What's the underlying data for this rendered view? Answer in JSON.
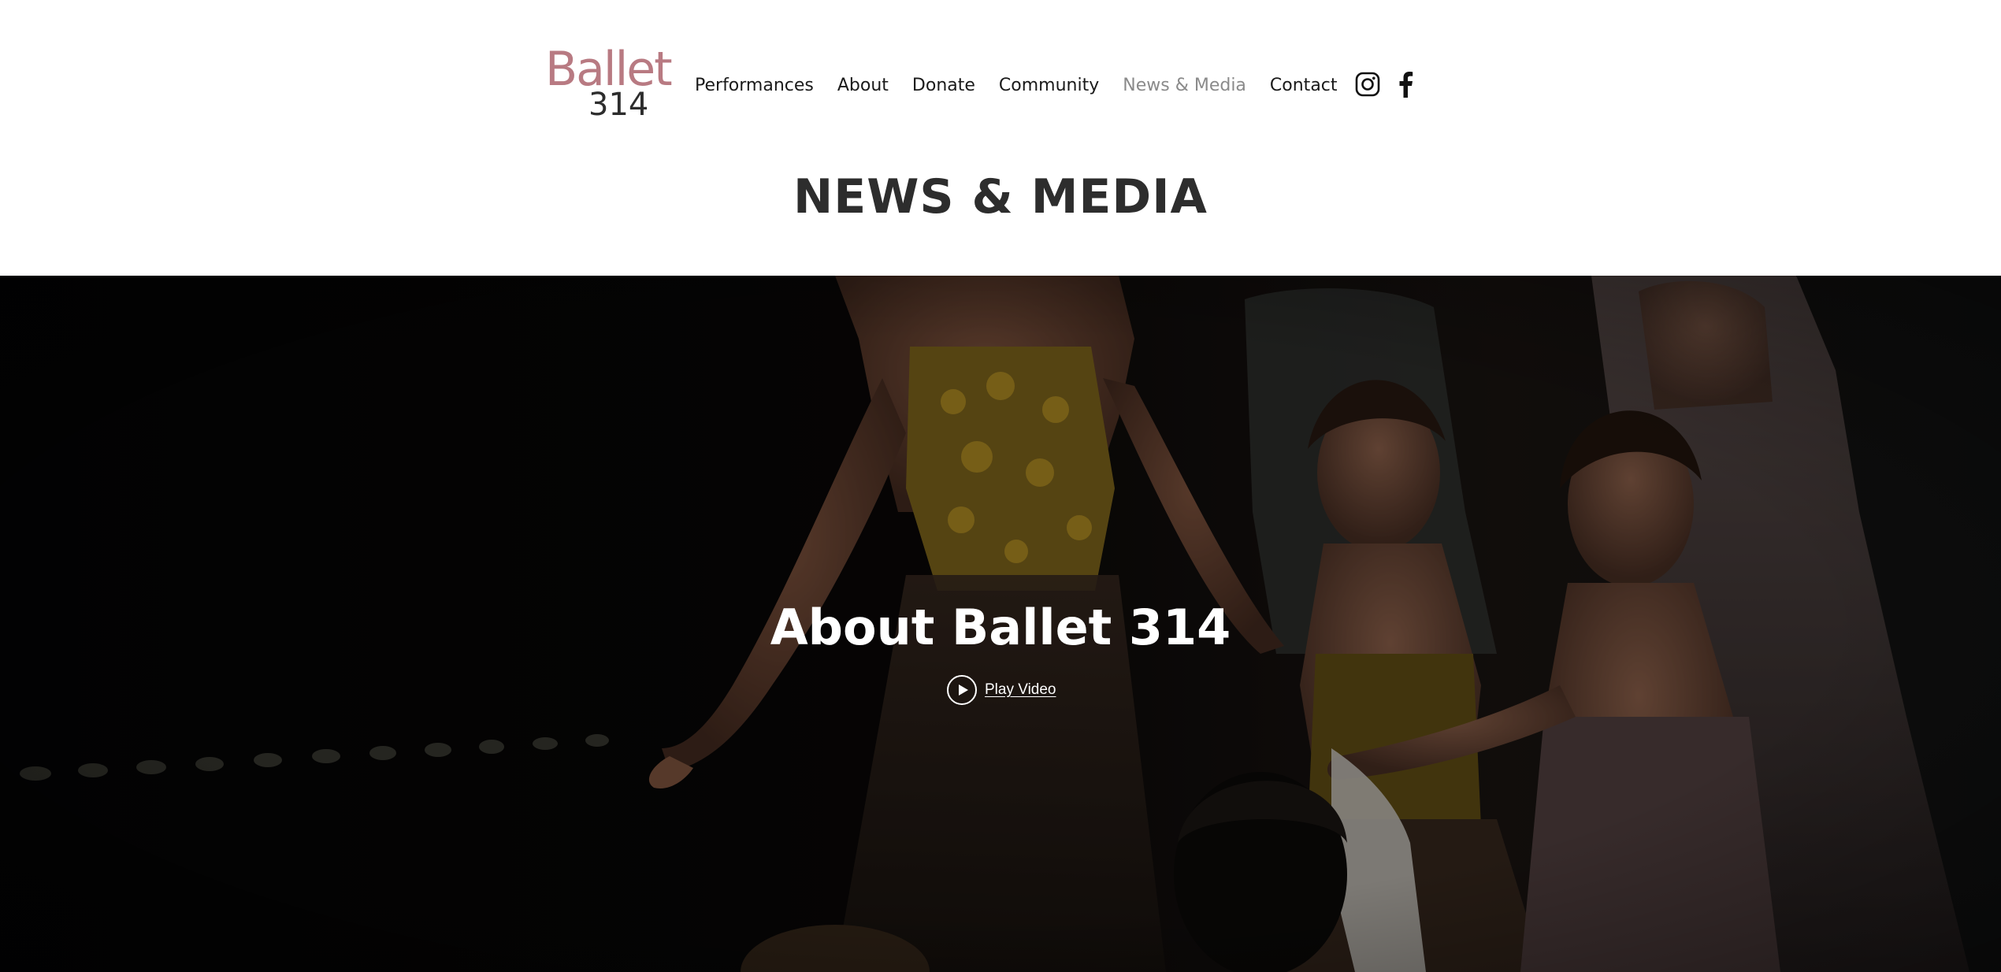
{
  "header": {
    "logo": {
      "word": "Ballet",
      "number": "314"
    },
    "nav": {
      "items": [
        {
          "label": "Performances",
          "active": false
        },
        {
          "label": "About",
          "active": false
        },
        {
          "label": "Donate",
          "active": false
        },
        {
          "label": "Community",
          "active": false
        },
        {
          "label": "News & Media",
          "active": true
        },
        {
          "label": "Contact",
          "active": false
        }
      ]
    },
    "social": [
      {
        "icon": "instagram-icon"
      },
      {
        "icon": "facebook-icon"
      }
    ]
  },
  "page": {
    "title": "NEWS & MEDIA"
  },
  "hero": {
    "title": "About Ballet 314",
    "play_label": "Play Video",
    "photo_subject": "ballet dancers on a dark stage"
  },
  "colors": {
    "logo_accent": "#b87a82",
    "text_dark": "#2d2d2d",
    "nav_active": "#8a8a8a",
    "hero_background": "#060608"
  }
}
